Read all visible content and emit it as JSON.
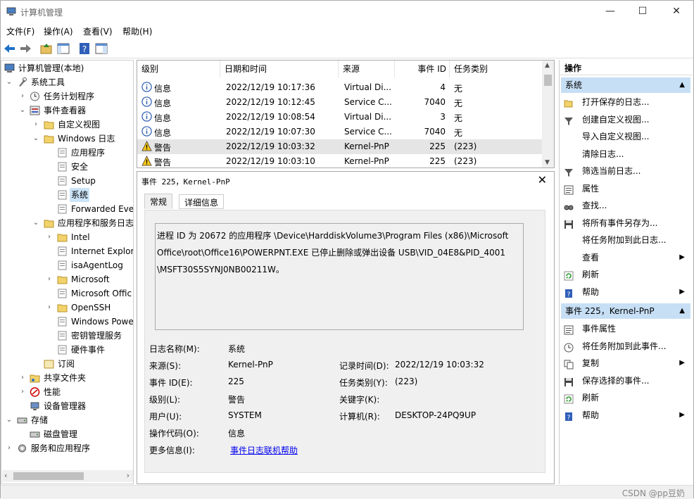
{
  "window": {
    "title": "计算机管理",
    "minimize": "—",
    "maximize": "☐",
    "close": "✕"
  },
  "menu": [
    "文件(F)",
    "操作(A)",
    "查看(V)",
    "帮助(H)"
  ],
  "tree": {
    "root": "计算机管理(本地)",
    "system_tools": "系统工具",
    "task_scheduler": "任务计划程序",
    "event_viewer": "事件查看器",
    "custom_views": "自定义视图",
    "windows_logs": "Windows 日志",
    "app_log": "应用程序",
    "security_log": "安全",
    "setup_log": "Setup",
    "system_log": "系统",
    "forwarded": "Forwarded Eve",
    "apps_services_logs": "应用程序和服务日志",
    "intel": "Intel",
    "ie": "Internet Explor",
    "isa": "isaAgentLog",
    "microsoft": "Microsoft",
    "ms_office": "Microsoft Offic",
    "openssh": "OpenSSH",
    "powershell": "Windows Powe",
    "key_mgmt": "密钥管理服务",
    "hw_events": "硬件事件",
    "subscriptions": "订阅",
    "shared_folders": "共享文件夹",
    "performance": "性能",
    "device_manager": "设备管理器",
    "storage": "存储",
    "disk_mgmt": "磁盘管理",
    "services_apps": "服务和应用程序"
  },
  "grid": {
    "headers": [
      "级别",
      "日期和时间",
      "来源",
      "事件 ID",
      "任务类别"
    ],
    "rows": [
      {
        "level": "信息",
        "type": "info",
        "time": "2022/12/19 10:17:36",
        "source": "Virtual Di...",
        "id": "4",
        "category": "无"
      },
      {
        "level": "信息",
        "type": "info",
        "time": "2022/12/19 10:12:45",
        "source": "Service C...",
        "id": "7040",
        "category": "无"
      },
      {
        "level": "信息",
        "type": "info",
        "time": "2022/12/19 10:08:54",
        "source": "Virtual Di...",
        "id": "3",
        "category": "无"
      },
      {
        "level": "信息",
        "type": "info",
        "time": "2022/12/19 10:07:30",
        "source": "Service C...",
        "id": "7040",
        "category": "无"
      },
      {
        "level": "警告",
        "type": "warn",
        "time": "2022/12/19 10:03:32",
        "source": "Kernel-PnP",
        "id": "225",
        "category": "(223)"
      },
      {
        "level": "警告",
        "type": "warn",
        "time": "2022/12/19 10:03:10",
        "source": "Kernel-PnP",
        "id": "225",
        "category": "(223)"
      }
    ]
  },
  "detail": {
    "header": "事件 225，Kernel-PnP",
    "tab_general": "常规",
    "tab_details": "详细信息",
    "description_lines": [
      "进程 ID 为 20672 的应用程序 \\Device\\HarddiskVolume3\\Program Files (x86)\\Microsoft",
      "Office\\root\\Office16\\POWERPNT.EXE 已停止删除或弹出设备 USB\\VID_04E8&PID_4001",
      "\\MSFT30S5SYNJ0NB00211W。"
    ],
    "log_name_label": "日志名称(M):",
    "log_name": "系统",
    "source_label": "来源(S):",
    "source": "Kernel-PnP",
    "logged_label": "记录时间(D):",
    "logged": "2022/12/19 10:03:32",
    "event_id_label": "事件 ID(E):",
    "event_id": "225",
    "category_label": "任务类别(Y):",
    "category": "(223)",
    "level_label": "级别(L):",
    "level": "警告",
    "keywords_label": "关键字(K):",
    "keywords": "",
    "user_label": "用户(U):",
    "user": "SYSTEM",
    "computer_label": "计算机(R):",
    "computer": "DESKTOP-24PQ9UP",
    "opcode_label": "操作代码(O):",
    "opcode": "信息",
    "more_info_label": "更多信息(I):",
    "more_info_link": "事件日志联机帮助"
  },
  "actions": {
    "title": "操作",
    "section1": "系统",
    "items1": [
      {
        "label": "打开保存的日志...",
        "icon": "folder-open-icon"
      },
      {
        "label": "创建自定义视图...",
        "icon": "filter-icon"
      },
      {
        "label": "导入自定义视图...",
        "icon": ""
      },
      {
        "label": "清除日志...",
        "icon": ""
      },
      {
        "label": "筛选当前日志...",
        "icon": "filter-icon"
      },
      {
        "label": "属性",
        "icon": "properties-icon"
      },
      {
        "label": "查找...",
        "icon": "find-icon"
      },
      {
        "label": "将所有事件另存为...",
        "icon": "save-icon"
      },
      {
        "label": "将任务附加到此日志...",
        "icon": ""
      },
      {
        "label": "查看",
        "icon": "",
        "submenu": true
      },
      {
        "label": "刷新",
        "icon": "refresh-icon"
      },
      {
        "label": "帮助",
        "icon": "help-icon",
        "submenu": true
      }
    ],
    "section2": "事件 225，Kernel-PnP",
    "items2": [
      {
        "label": "事件属性",
        "icon": "properties-icon"
      },
      {
        "label": "将任务附加到此事件...",
        "icon": "task-icon"
      },
      {
        "label": "复制",
        "icon": "copy-icon",
        "submenu": true
      },
      {
        "label": "保存选择的事件...",
        "icon": "save-icon"
      },
      {
        "label": "刷新",
        "icon": "refresh-icon"
      },
      {
        "label": "帮助",
        "icon": "help-icon",
        "submenu": true
      }
    ]
  },
  "watermark": "CSDN @pp豆奶"
}
